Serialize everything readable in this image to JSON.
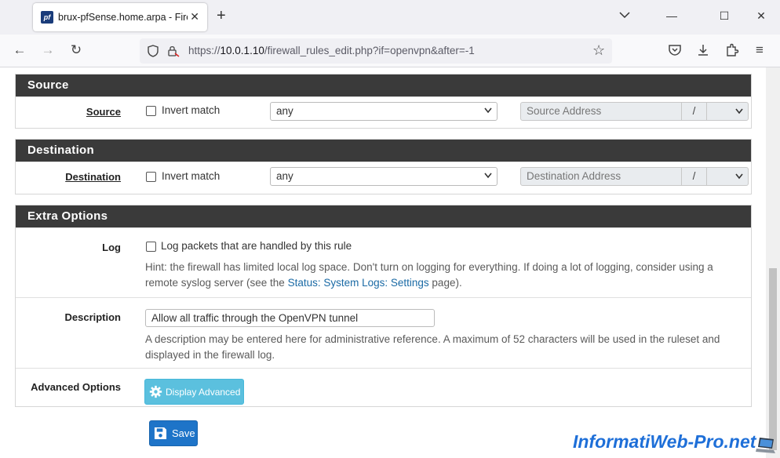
{
  "browser": {
    "tab_title": "brux-pfSense.home.arpa - Firewall: Rules: Edit",
    "favicon_text": "pf",
    "url_prefix": "https://",
    "url_host": "10.0.1.10",
    "url_path": "/firewall_rules_edit.php?if=openvpn&after=-1",
    "icons": [
      "back-icon",
      "forward-icon",
      "reload-icon",
      "shield-icon",
      "lock-icon",
      "star-icon",
      "pocket-icon",
      "download-icon",
      "extensions-icon",
      "menu-icon"
    ]
  },
  "source": {
    "header": "Source",
    "label": "Source",
    "invert_label": "Invert match",
    "type_value": "any",
    "address_placeholder": "Source Address",
    "slash": "/"
  },
  "destination": {
    "header": "Destination",
    "label": "Destination",
    "invert_label": "Invert match",
    "type_value": "any",
    "address_placeholder": "Destination Address",
    "slash": "/"
  },
  "extra": {
    "header": "Extra Options",
    "log_label": "Log",
    "log_checkbox_label": "Log packets that are handled by this rule",
    "log_hint_1": "Hint: the firewall has limited local log space. Don't turn on logging for everything. If doing a lot of logging, consider using a",
    "log_hint_2a": "remote syslog server (see the ",
    "log_hint_link": "Status: System Logs: Settings",
    "log_hint_2b": " page).",
    "description_label": "Description",
    "description_value": "Allow all traffic through the OpenVPN tunnel",
    "description_hint_1": "A description may be entered here for administrative reference. A maximum of 52 characters will be used in the ruleset and",
    "description_hint_2": "displayed in the firewall log.",
    "advanced_label": "Advanced Options",
    "advanced_button": "Display Advanced"
  },
  "save_button": "Save",
  "watermark": "InformatiWeb-Pro.net",
  "colors": {
    "panel_header": "#3a3a3a",
    "info_button": "#5bc0de",
    "primary_button": "#1e74c8",
    "link": "#1a6aa5"
  }
}
